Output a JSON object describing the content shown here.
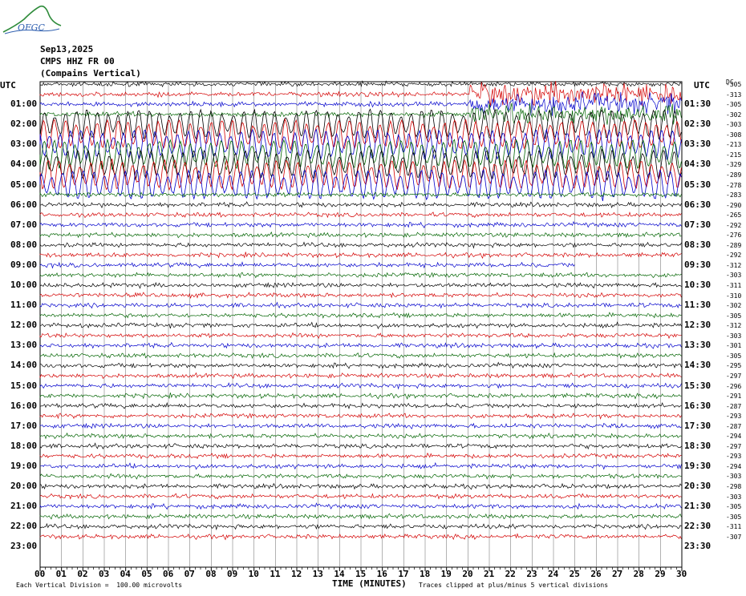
{
  "logo": {
    "text": "OFGC"
  },
  "header": {
    "date": "Sep13,2025",
    "station": "CMPS HHZ FR 00",
    "location": "(Compains Vertical)"
  },
  "utc_left": "UTC",
  "utc_right": "UTC",
  "offset_header": "DC",
  "left_hours": [
    "01:00",
    "02:00",
    "03:00",
    "04:00",
    "05:00",
    "06:00",
    "07:00",
    "08:00",
    "09:00",
    "10:00",
    "11:00",
    "12:00",
    "13:00",
    "14:00",
    "15:00",
    "16:00",
    "17:00",
    "18:00",
    "19:00",
    "20:00",
    "21:00",
    "22:00",
    "23:00"
  ],
  "right_hours": [
    "01:30",
    "02:30",
    "03:30",
    "04:30",
    "05:30",
    "06:30",
    "07:30",
    "08:30",
    "09:30",
    "10:30",
    "11:30",
    "12:30",
    "13:30",
    "14:30",
    "15:30",
    "16:30",
    "17:30",
    "18:30",
    "19:30",
    "20:30",
    "21:30",
    "22:30",
    "23:30"
  ],
  "footer": {
    "xlabel": "TIME (MINUTES)",
    "scale_note": "Each Vertical Division =  100.00 microvolts",
    "clip_note": "Traces clipped at plus/minus 5 vertical divisions"
  },
  "chart_data": {
    "type": "line",
    "title": "CMPS HHZ FR 00",
    "xlabel": "TIME (MINUTES)",
    "xlim": [
      0,
      30
    ],
    "x_ticks": [
      "00",
      "01",
      "02",
      "03",
      "04",
      "05",
      "06",
      "07",
      "08",
      "09",
      "10",
      "11",
      "12",
      "13",
      "14",
      "15",
      "16",
      "17",
      "18",
      "19",
      "20",
      "21",
      "22",
      "23",
      "24",
      "25",
      "26",
      "27",
      "28",
      "29",
      "30"
    ],
    "trace_colors": [
      "#000000",
      "#d40000",
      "#0000cc",
      "#006400"
    ],
    "trace_dc_offsets": [
      -305,
      -313,
      -305,
      -302,
      -303,
      -308,
      -213,
      -215,
      -329,
      -289,
      -278,
      -283,
      -290,
      -265,
      -292,
      -276,
      -289,
      -292,
      -312,
      -303,
      -311,
      -310,
      -302,
      -305,
      -312,
      -303,
      -301,
      -305,
      -295,
      -297,
      -296,
      -291,
      -287,
      -293,
      -287,
      -294,
      -297,
      -293,
      -294,
      -303,
      -298,
      -303,
      -305,
      -305,
      -311,
      -307
    ],
    "grid": true,
    "data_end_trace_index": 18,
    "data_end_minute": 25
  }
}
